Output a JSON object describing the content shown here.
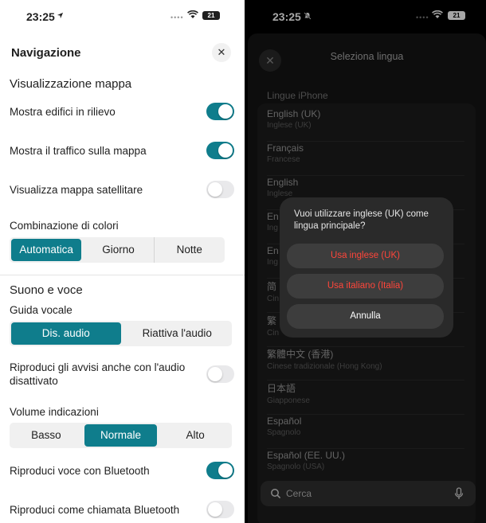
{
  "left": {
    "status": {
      "time": "23:25",
      "battery": "21"
    },
    "header": {
      "title": "Navigazione",
      "close": "✕"
    },
    "map_section": {
      "title": "Visualizzazione mappa",
      "rows": [
        {
          "label": "Mostra edifici in rilievo",
          "on": true
        },
        {
          "label": "Mostra il traffico sulla mappa",
          "on": true
        },
        {
          "label": "Visualizza mappa satellitare",
          "on": false
        }
      ],
      "color_scheme_label": "Combinazione di colori",
      "color_scheme_options": [
        "Automatica",
        "Giorno",
        "Notte"
      ],
      "color_scheme_selected": "Automatica"
    },
    "sound_section": {
      "title": "Suono e voce",
      "voice_label": "Guida vocale",
      "voice_options": [
        "Dis. audio",
        "Riattiva l'audio"
      ],
      "voice_selected": "Dis. audio",
      "muted_alerts": {
        "label": "Riproduci gli avvisi anche con l'audio disattivato",
        "on": false
      },
      "volume_label": "Volume indicazioni",
      "volume_options": [
        "Basso",
        "Normale",
        "Alto"
      ],
      "volume_selected": "Normale",
      "bluetooth_voice": {
        "label": "Riproduci voce con Bluetooth",
        "on": true
      },
      "bluetooth_call": {
        "label": "Riproduci come chiamata Bluetooth",
        "on": false
      }
    }
  },
  "right": {
    "status": {
      "time": "23:25",
      "battery": "21"
    },
    "sheet": {
      "close": "✕",
      "title": "Seleziona lingua",
      "group_title": "Lingue iPhone",
      "languages": [
        {
          "name": "English (UK)",
          "sub": "Inglese (UK)"
        },
        {
          "name": "Français",
          "sub": "Francese"
        },
        {
          "name": "English",
          "sub": "Inglese"
        },
        {
          "name": "En",
          "sub": "Ing"
        },
        {
          "name": "En",
          "sub": "Ing"
        },
        {
          "name": "简",
          "sub": "Cin"
        },
        {
          "name": "繁",
          "sub": "Cin"
        },
        {
          "name": "繁體中文 (香港)",
          "sub": "Cinese tradizionale (Hong Kong)"
        },
        {
          "name": "日本語",
          "sub": "Giapponese"
        },
        {
          "name": "Español",
          "sub": "Spagnolo"
        },
        {
          "name": "Español (EE. UU.)",
          "sub": "Spagnolo (USA)"
        }
      ],
      "search_placeholder": "Cerca"
    },
    "dialog": {
      "message": "Vuoi utilizzare inglese (UK) come lingua principale?",
      "btn_english": "Usa inglese (UK)",
      "btn_italian": "Usa italiano (Italia)",
      "btn_cancel": "Annulla"
    }
  },
  "colors": {
    "accent": "#0f7d8c",
    "destructive": "#ff453a"
  }
}
